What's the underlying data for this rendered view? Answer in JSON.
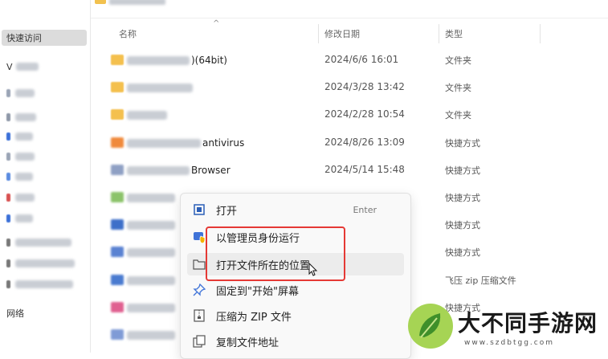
{
  "sidebar": {
    "quick_access_label": "快速访问",
    "item_v_label": "V",
    "bottom_label": "网络"
  },
  "columns": {
    "name": "名称",
    "date": "修改日期",
    "type": "类型"
  },
  "files": [
    {
      "name_suffix": ")(64bit)",
      "date": "2024/6/6 16:01",
      "type": "文件夹",
      "icon": "folder"
    },
    {
      "name_suffix": "",
      "date": "2024/3/28 13:42",
      "type": "文件夹",
      "icon": "folder"
    },
    {
      "name_suffix": "",
      "date": "2024/2/28 10:54",
      "type": "文件夹",
      "icon": "folder"
    },
    {
      "name_suffix": "antivirus",
      "date": "2024/8/26 13:09",
      "type": "快捷方式",
      "icon": "app"
    },
    {
      "name_suffix": "Browser",
      "date": "2024/5/14 15:48",
      "type": "快捷方式",
      "icon": "app"
    },
    {
      "name_suffix": "",
      "date": "",
      "type": "快捷方式",
      "icon": "app"
    },
    {
      "name_suffix": "",
      "date": "",
      "type": "快捷方式",
      "icon": "app"
    },
    {
      "name_suffix": "",
      "date": "",
      "type": "快捷方式",
      "icon": "app"
    },
    {
      "name_suffix": "",
      "date": "",
      "type": "飞压 zip 压缩文件",
      "icon": "app"
    },
    {
      "name_suffix": "",
      "date": "",
      "type": "快捷方式",
      "icon": "app"
    },
    {
      "name_suffix": "",
      "date": "",
      "type": "快捷方式",
      "icon": "app"
    }
  ],
  "context_menu": {
    "open": "打开",
    "open_shortcut": "Enter",
    "run_as_admin": "以管理员身份运行",
    "open_file_location": "打开文件所在的位置",
    "pin_to_start": "固定到\"开始\"屏幕",
    "compress_zip": "压缩为 ZIP 文件",
    "copy_path": "复制文件地址"
  },
  "watermark": {
    "title": "大不同手游网",
    "url": "www.szdbtgg.com"
  },
  "colors": {
    "highlight": "#e53935",
    "folder": "#f4c04e",
    "menu_bg": "#f9f9f9"
  }
}
